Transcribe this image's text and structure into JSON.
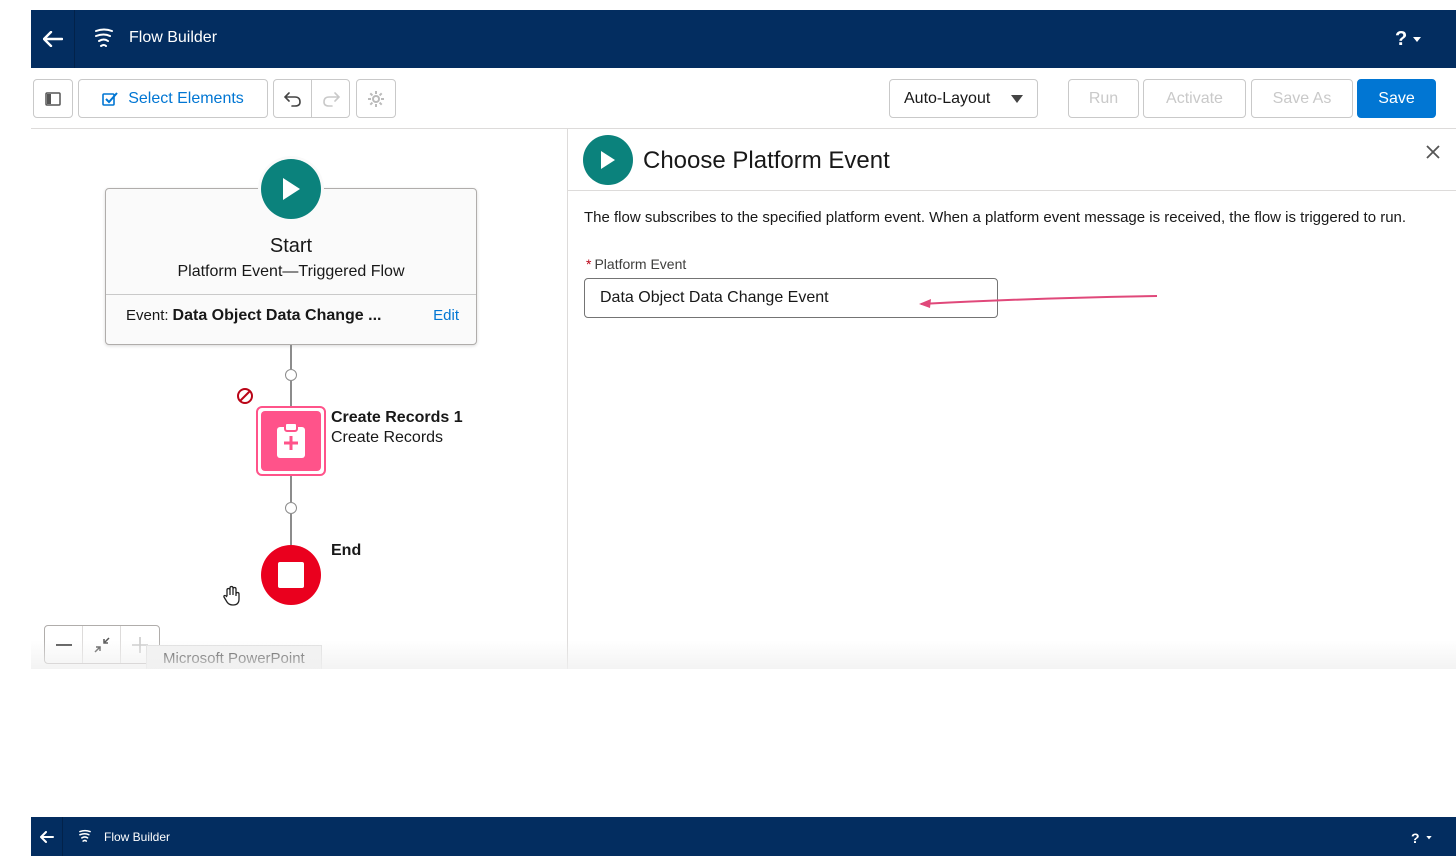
{
  "app": {
    "title": "Flow Builder",
    "help_label": "?"
  },
  "toolbar": {
    "select_elements_label": "Select Elements",
    "layout_select_value": "Auto-Layout",
    "run_label": "Run",
    "activate_label": "Activate",
    "save_as_label": "Save As",
    "save_label": "Save"
  },
  "canvas": {
    "start": {
      "title": "Start",
      "subtitle": "Platform Event—Triggered Flow",
      "event_label": "Event:",
      "event_value": "Data Object Data Change ...",
      "edit_label": "Edit"
    },
    "create_node": {
      "name": "Create Records 1",
      "type": "Create Records"
    },
    "end_node": {
      "label": "End"
    },
    "tooltip": "Microsoft PowerPoint"
  },
  "panel": {
    "title": "Choose Platform Event",
    "description": "The flow subscribes to the specified platform event. When a platform event message is received, the flow is triggered to run.",
    "field_label": "Platform Event",
    "field_required_marker": "*",
    "field_value": "Data Object Data Change Event"
  },
  "colors": {
    "header_bg": "#032d60",
    "brand_blue": "#0176d3",
    "start_teal": "#0b827c",
    "create_pink": "#ff538a",
    "end_red": "#ea001e",
    "annotation_arrow": "#e0487a"
  }
}
